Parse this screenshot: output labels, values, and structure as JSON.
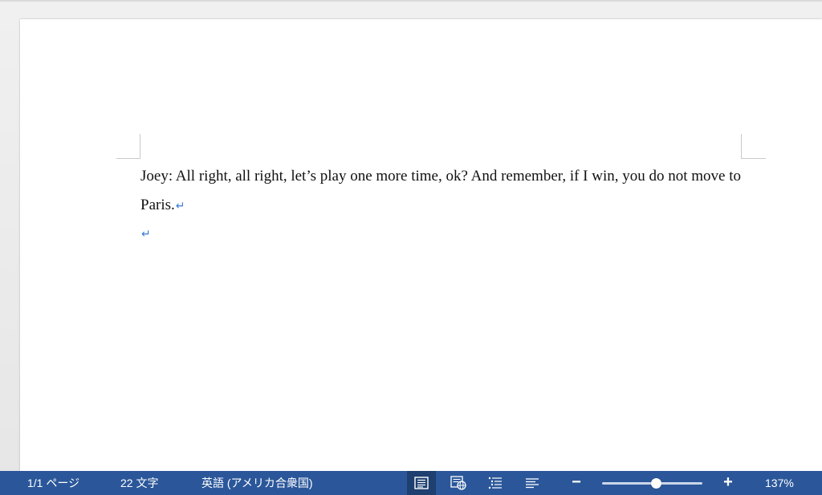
{
  "document": {
    "paragraphs": [
      "Joey: All right, all right, let’s play one more time, ok? And remember, if I win, you do not move to Paris.",
      ""
    ],
    "paragraph_mark": "↵"
  },
  "status_bar": {
    "page_count": "1/1 ページ",
    "word_count": "22 文字",
    "language": "英語 (アメリカ合衆国)",
    "views": [
      {
        "name": "print-layout",
        "icon": "print-layout-icon",
        "active": true
      },
      {
        "name": "web-layout",
        "icon": "web-layout-icon",
        "active": false
      },
      {
        "name": "outline",
        "icon": "outline-icon",
        "active": false
      },
      {
        "name": "draft",
        "icon": "draft-icon",
        "active": false
      }
    ],
    "zoom_minus": "−",
    "zoom_plus": "+",
    "zoom_level": "137%",
    "zoom_slider_fraction": 0.54,
    "colors": {
      "background": "#2b579a",
      "active_view": "#1e3f70"
    }
  }
}
